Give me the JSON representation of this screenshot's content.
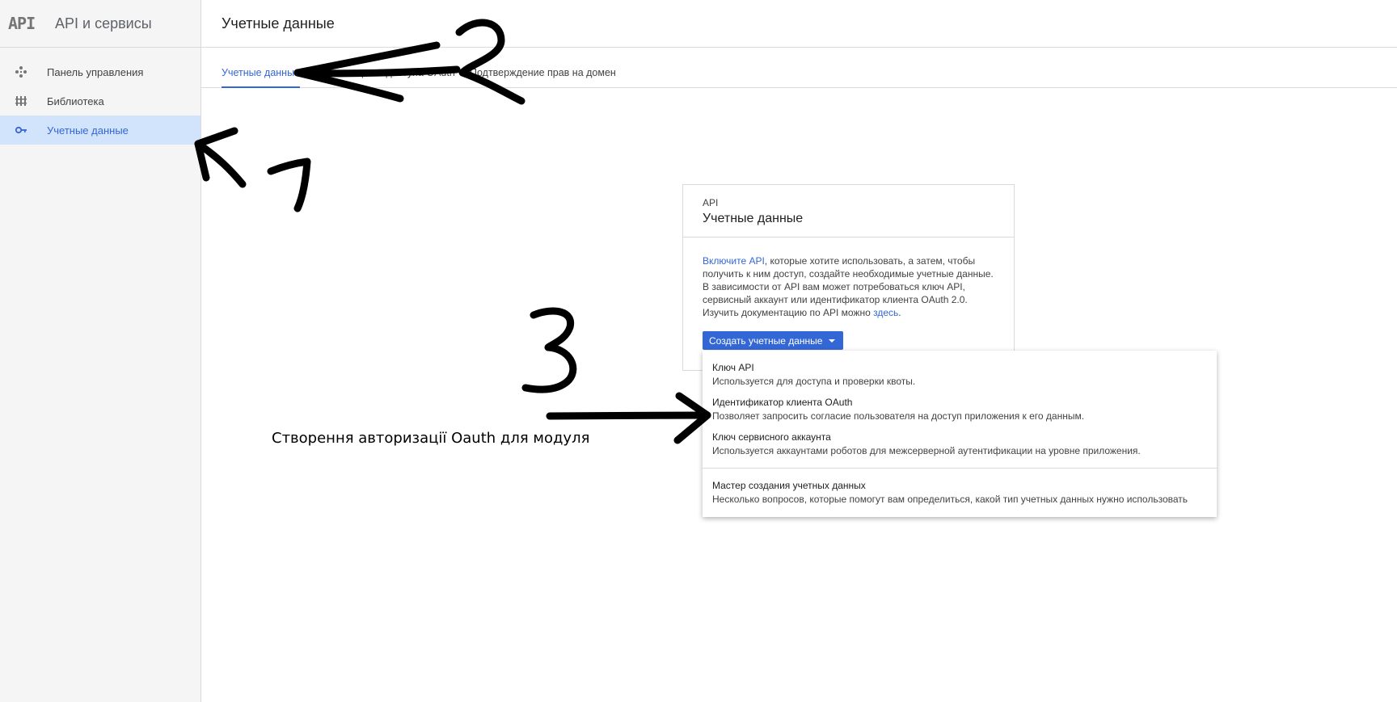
{
  "sidebar": {
    "logo": "API",
    "title": "API и сервисы",
    "items": [
      {
        "label": "Панель управления",
        "icon": "dashboard-icon"
      },
      {
        "label": "Библиотека",
        "icon": "library-icon"
      },
      {
        "label": "Учетные данные",
        "icon": "key-icon",
        "active": true
      }
    ]
  },
  "header": {
    "title": "Учетные данные"
  },
  "tabs": [
    {
      "label": "Учетные данные",
      "active": true
    },
    {
      "label": "Окно запроса доступа OAuth"
    },
    {
      "label": "Подтверждение прав на домен"
    }
  ],
  "card": {
    "eyebrow": "API",
    "title": "Учетные данные",
    "body_link": "Включите API",
    "body_text": ", которые хотите использовать, а затем, чтобы получить к ним доступ, создайте необходимые учетные данные. В зависимости от API вам может потребоваться ключ API, сервисный аккаунт или идентификатор клиента OAuth 2.0. Изучить документацию по API можно ",
    "body_link2": "здесь",
    "body_end": ".",
    "button": "Создать учетные данные"
  },
  "menu": {
    "items": [
      {
        "title": "Ключ API",
        "desc": "Используется для доступа и проверки квоты."
      },
      {
        "title": "Идентификатор клиента OAuth",
        "desc": "Позволяет запросить согласие пользователя на доступ приложения к его данным."
      },
      {
        "title": "Ключ сервисного аккаунта",
        "desc": "Используется аккаунтами роботов для межсерверной аутентификации на уровне приложения."
      },
      {
        "title": "Мастер создания учетных данных",
        "desc": "Несколько вопросов, которые помогут вам определиться, какой тип учетных данных нужно использовать"
      }
    ]
  },
  "annotations": {
    "text": "Створення авторизації Oauth для модуля",
    "marks": [
      "1",
      "2",
      "3"
    ],
    "color": "#000000"
  },
  "colors": {
    "accent": "#3367d6",
    "active_bg": "#d2e3fc"
  }
}
